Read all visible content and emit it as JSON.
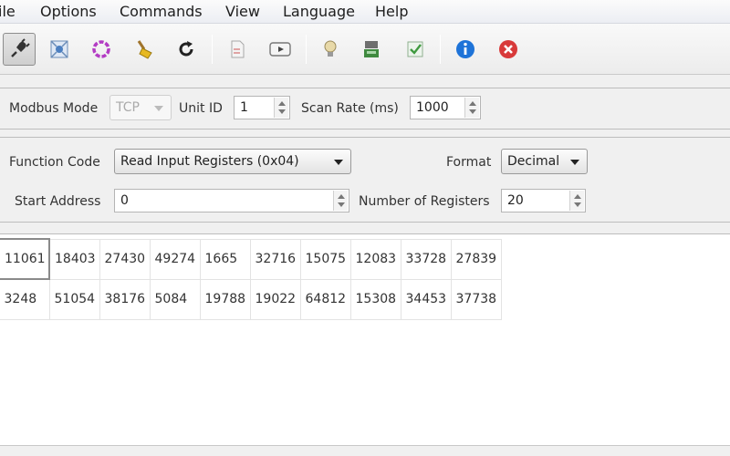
{
  "menu": [
    "ile",
    "Options",
    "Commands",
    "View",
    "Language",
    "Help"
  ],
  "toolbar": {
    "icons": [
      "plug-icon",
      "network-icon",
      "ring-icon",
      "broom-icon",
      "refresh-icon",
      "page-icon",
      "play-icon",
      "bulb-icon",
      "device-icon",
      "check-icon",
      "info-icon",
      "close-icon"
    ],
    "colors": {
      "info": "#1e73d8",
      "stop": "#d83a3a",
      "ring": "#b33cc4"
    }
  },
  "connection": {
    "mode_label": "Modbus Mode",
    "mode_value": "TCP",
    "unit_label": "Unit ID",
    "unit_value": "1",
    "scan_label": "Scan Rate (ms)",
    "scan_value": "1000"
  },
  "request": {
    "function_label": "Function Code",
    "function_value": "Read Input Registers (0x04)",
    "format_label": "Format",
    "format_value": "Decimal",
    "start_label": "Start Address",
    "start_value": "0",
    "count_label": "Number of Registers",
    "count_value": "20"
  },
  "registers": [
    [
      "11061",
      "18403",
      "27430",
      "49274",
      "1665",
      "32716",
      "15075",
      "12083",
      "33728",
      "27839"
    ],
    [
      "3248",
      "51054",
      "38176",
      "5084",
      "19788",
      "19022",
      "64812",
      "15308",
      "34453",
      "37738"
    ]
  ]
}
